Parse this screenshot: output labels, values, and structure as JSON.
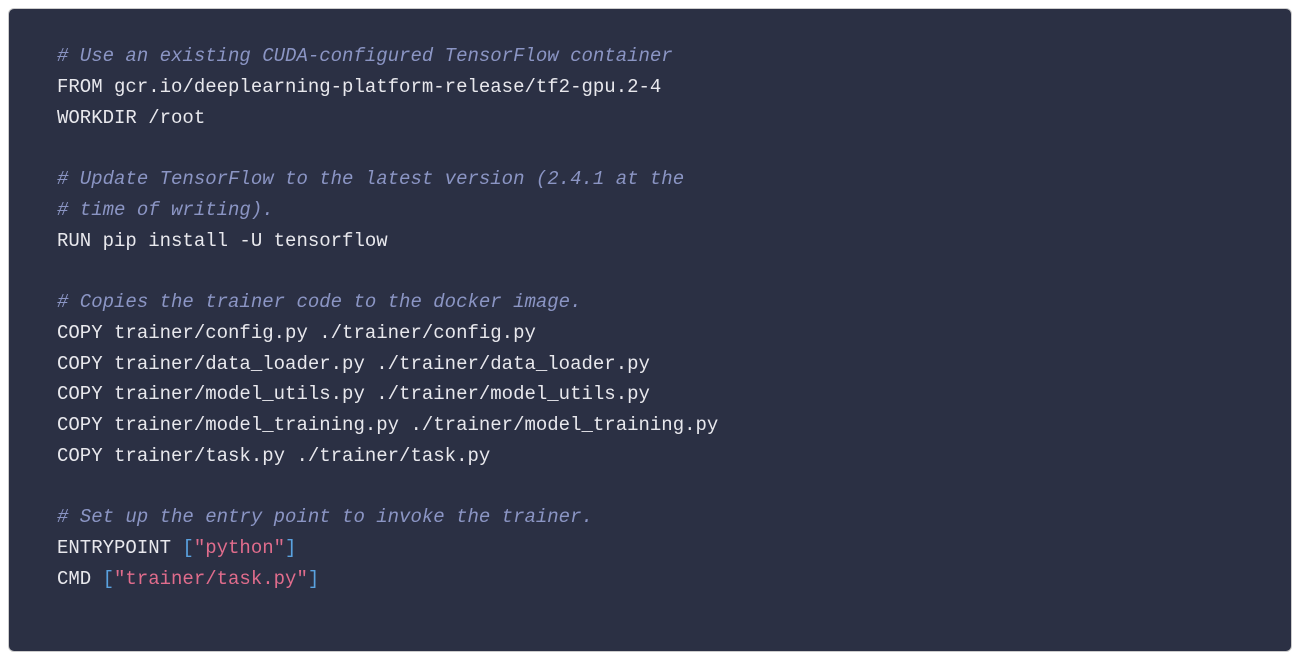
{
  "code": {
    "lines": [
      {
        "type": "comment",
        "text": "# Use an existing CUDA-configured TensorFlow container"
      },
      {
        "type": "plain",
        "text": "FROM gcr.io/deeplearning-platform-release/tf2-gpu.2-4"
      },
      {
        "type": "plain",
        "text": "WORKDIR /root"
      },
      {
        "type": "blank",
        "text": ""
      },
      {
        "type": "comment",
        "text": "# Update TensorFlow to the latest version (2.4.1 at the"
      },
      {
        "type": "comment",
        "text": "# time of writing)."
      },
      {
        "type": "plain",
        "text": "RUN pip install -U tensorflow"
      },
      {
        "type": "blank",
        "text": ""
      },
      {
        "type": "comment",
        "text": "# Copies the trainer code to the docker image."
      },
      {
        "type": "plain",
        "text": "COPY trainer/config.py ./trainer/config.py"
      },
      {
        "type": "plain",
        "text": "COPY trainer/data_loader.py ./trainer/data_loader.py"
      },
      {
        "type": "plain",
        "text": "COPY trainer/model_utils.py ./trainer/model_utils.py"
      },
      {
        "type": "plain",
        "text": "COPY trainer/model_training.py ./trainer/model_training.py"
      },
      {
        "type": "plain",
        "text": "COPY trainer/task.py ./trainer/task.py"
      },
      {
        "type": "blank",
        "text": ""
      },
      {
        "type": "comment",
        "text": "# Set up the entry point to invoke the trainer."
      },
      {
        "type": "entrypoint",
        "keyword": "ENTRYPOINT ",
        "open": "[",
        "string": "\"python\"",
        "close": "]"
      },
      {
        "type": "cmd",
        "keyword": "CMD ",
        "open": "[",
        "string": "\"trainer/task.py\"",
        "close": "]"
      }
    ]
  }
}
